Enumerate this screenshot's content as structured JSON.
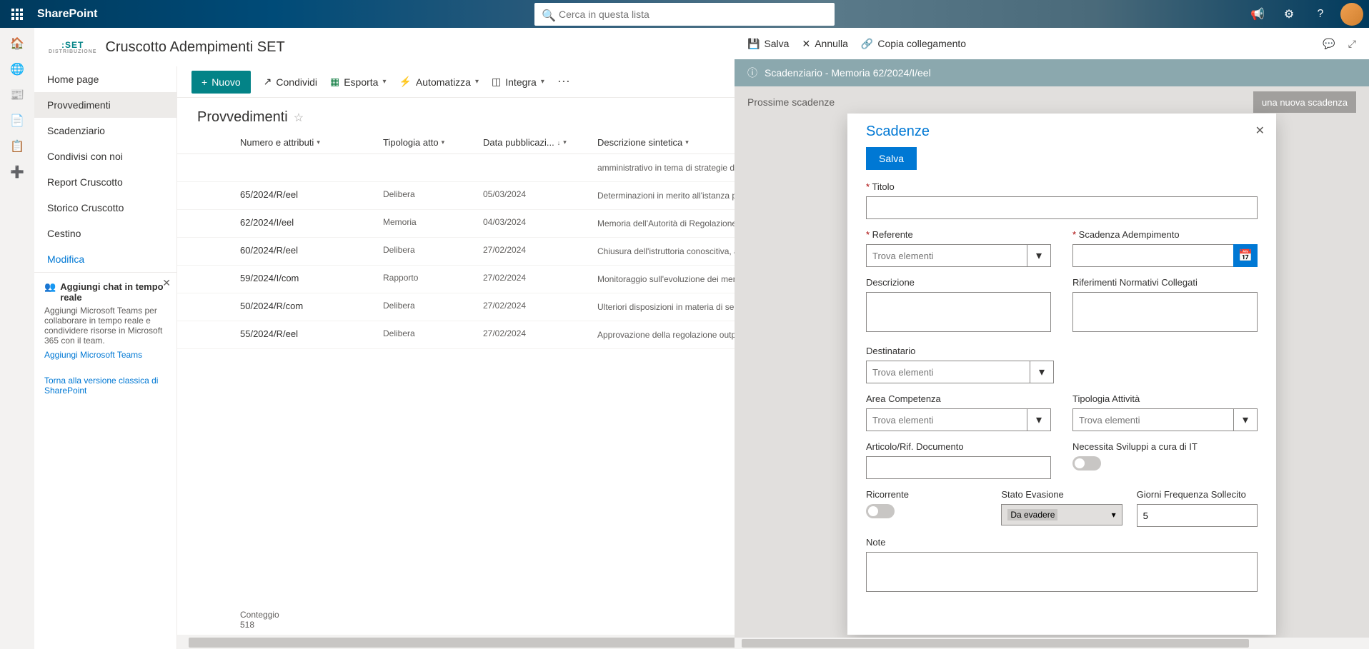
{
  "topbar": {
    "brand": "SharePoint",
    "search_placeholder": "Cerca in questa lista"
  },
  "site": {
    "logo_top": ":SET",
    "logo_sub": "DISTRIBUZIONE",
    "title": "Cruscotto Adempimenti SET"
  },
  "nav": {
    "items": [
      "Home page",
      "Provvedimenti",
      "Scadenziario",
      "Condivisi con noi",
      "Report Cruscotto",
      "Storico Cruscotto",
      "Cestino"
    ],
    "edit": "Modifica"
  },
  "teams": {
    "title": "Aggiungi chat in tempo reale",
    "desc": "Aggiungi Microsoft Teams per collaborare in tempo reale e condividere risorse in Microsoft 365 con il team.",
    "link": "Aggiungi Microsoft Teams"
  },
  "classic": "Torna alla versione classica di SharePoint",
  "cmd": {
    "nuovo": "Nuovo",
    "condividi": "Condividi",
    "esporta": "Esporta",
    "automatizza": "Automatizza",
    "integra": "Integra"
  },
  "list": {
    "title": "Provvedimenti",
    "cols": {
      "num": "Numero e attributi",
      "tipo": "Tipologia atto",
      "data": "Data pubblicazi...",
      "desc": "Descrizione sintetica"
    },
    "rows": [
      {
        "num": "",
        "tipo": "",
        "data": "",
        "desc": "amministrativo in tema di strategie di proposta non diligenti di energia elettrica"
      },
      {
        "num": "65/2024/R/eel",
        "tipo": "Delibera",
        "data": "05/03/2024",
        "desc": "Determinazioni in merito all'istanza per il riconoscimento del corrispettivo di reintegrazione relativo all'impianto essenziale elettrica di Capri, per l'anno 2022"
      },
      {
        "num": "62/2024/I/eel",
        "tipo": "Memoria",
        "data": "04/03/2024",
        "desc": "Memoria dell'Autorità di Regolazione per Energia Reti e Ambiente in merito agli esiti delle procedure concorsuali per l'assegnazione del servizio a tutele graduali per i clienti domestici non vulnerabili"
      },
      {
        "num": "60/2024/R/eel",
        "tipo": "Delibera",
        "data": "27/02/2024",
        "desc": "Chiusura dell'istruttoria conoscitiva, avviata con deliberazione dell'Autorità 475/2023/R/eel, in merito alla formazione dei prezzi di sbilanciamento, a seguito dell'avvio dell'operatività di Terna"
      },
      {
        "num": "59/2024/I/com",
        "tipo": "Rapporto",
        "data": "27/02/2024",
        "desc": "Monitoraggio sull'evoluzione dei mercati di vendita al dettaglio dell'energia elettrica e del gas. Rapporto di aggiornamento gennaio 2024"
      },
      {
        "num": "50/2024/R/com",
        "tipo": "Delibera",
        "data": "27/02/2024",
        "desc": "Ulteriori disposizioni in materia di servizi energetici e del servizio idrico integrato, a favore delle popolazioni colpite dagli eccezionali eventi meteorologici, verificatisi il giorno 2 novembre 2023"
      },
      {
        "num": "55/2024/R/eel",
        "tipo": "Delibera",
        "data": "27/02/2024",
        "desc": "Approvazione della regolazione output-based del servizio di trasmissione"
      }
    ],
    "count_label": "Conteggio",
    "count": "518"
  },
  "panel": {
    "save": "Salva",
    "annulla": "Annulla",
    "copia": "Copia collegamento",
    "banner": "Scadenziario - Memoria 62/2024/I/eel",
    "prossime": "Prossime scadenze",
    "nuova": "una nuova scadenza"
  },
  "form": {
    "title": "Scadenze",
    "save": "Salva",
    "titolo": "Titolo",
    "referente": "Referente",
    "referente_ph": "Trova elementi",
    "scadenza": "Scadenza Adempimento",
    "descrizione": "Descrizione",
    "riferimenti": "Riferimenti Normativi Collegati",
    "destinatario": "Destinatario",
    "destinatario_ph": "Trova elementi",
    "area": "Area Competenza",
    "area_ph": "Trova elementi",
    "tipologia": "Tipologia Attività",
    "tipologia_ph": "Trova elementi",
    "articolo": "Articolo/Rif. Documento",
    "necessita": "Necessita Sviluppi a cura di IT",
    "ricorrente": "Ricorrente",
    "stato": "Stato Evasione",
    "stato_val": "Da evadere",
    "giorni": "Giorni Frequenza Sollecito",
    "giorni_val": "5",
    "note": "Note"
  }
}
